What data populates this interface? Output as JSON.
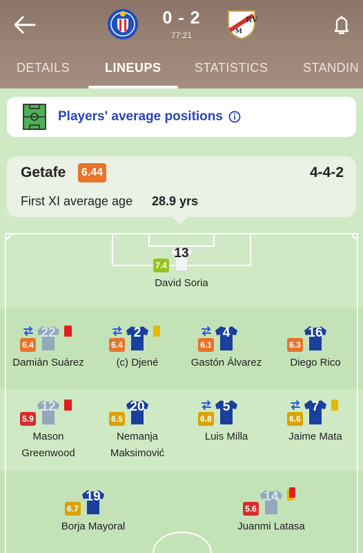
{
  "header": {
    "score": "0 - 2",
    "clock": "77:21",
    "tabs": [
      "DETAILS",
      "LINEUPS",
      "STATISTICS",
      "STANDIN"
    ],
    "active_tab": "LINEUPS"
  },
  "avg_positions": {
    "title": "Players' average positions"
  },
  "team": {
    "name": "Getafe",
    "rating": "6.44",
    "formation": "4-4-2",
    "age_label": "First XI average age",
    "age_value": "28.9 yrs"
  },
  "players": [
    {
      "id": "soria",
      "number": "13",
      "name": "David Soria",
      "rating": "7.4",
      "rating_color": "#9ac21c",
      "kit": "white",
      "subbed": false,
      "card": null
    },
    {
      "id": "suarez",
      "number": "22",
      "name": "Damián Suárez",
      "rating": "6.4",
      "rating_color": "#e8732a",
      "kit": "faded",
      "subbed": true,
      "card": "red"
    },
    {
      "id": "djene",
      "number": "2",
      "name": "(c) Djené",
      "rating": "6.4",
      "rating_color": "#e8732a",
      "kit": "blue",
      "subbed": true,
      "card": "yellow"
    },
    {
      "id": "alvarez",
      "number": "4",
      "name": "Gastón Álvarez",
      "rating": "6.1",
      "rating_color": "#e8732a",
      "kit": "blue",
      "subbed": true,
      "card": null
    },
    {
      "id": "rico",
      "number": "16",
      "name": "Diego Rico",
      "rating": "6.3",
      "rating_color": "#e8732a",
      "kit": "blue",
      "subbed": false,
      "card": null
    },
    {
      "id": "greenwood",
      "number": "12",
      "name_line1": "Mason",
      "name_line2": "Greenwood",
      "rating": "5.9",
      "rating_color": "#d92d2d",
      "kit": "faded",
      "subbed": false,
      "card": "red"
    },
    {
      "id": "maksimovic",
      "number": "20",
      "name_line1": "Nemanja",
      "name_line2": "Maksimović",
      "rating": "6.5",
      "rating_color": "#d9a300",
      "kit": "blue",
      "subbed": false,
      "card": null
    },
    {
      "id": "milla",
      "number": "5",
      "name": "Luis Milla",
      "rating": "6.8",
      "rating_color": "#d9a300",
      "kit": "blue",
      "subbed": true,
      "card": null
    },
    {
      "id": "mata",
      "number": "7",
      "name": "Jaime Mata",
      "rating": "6.6",
      "rating_color": "#d9a300",
      "kit": "blue",
      "subbed": true,
      "card": "yellow"
    },
    {
      "id": "mayoral",
      "number": "19",
      "name": "Borja Mayoral",
      "rating": "6.7",
      "rating_color": "#d9a300",
      "kit": "blue",
      "subbed": false,
      "card": null
    },
    {
      "id": "latasa",
      "number": "14",
      "name": "Juanmi Latasa",
      "rating": "5.6",
      "rating_color": "#d92d2d",
      "kit": "faded",
      "subbed": false,
      "card": "yellow-red"
    }
  ],
  "colors": {
    "kit_blue": "#1b3f9c",
    "kit_faded": "#93a8bb",
    "pitch_light": "#cfe9c4",
    "pitch_dark": "#c4e2b8",
    "link_blue": "#2a44b8"
  }
}
